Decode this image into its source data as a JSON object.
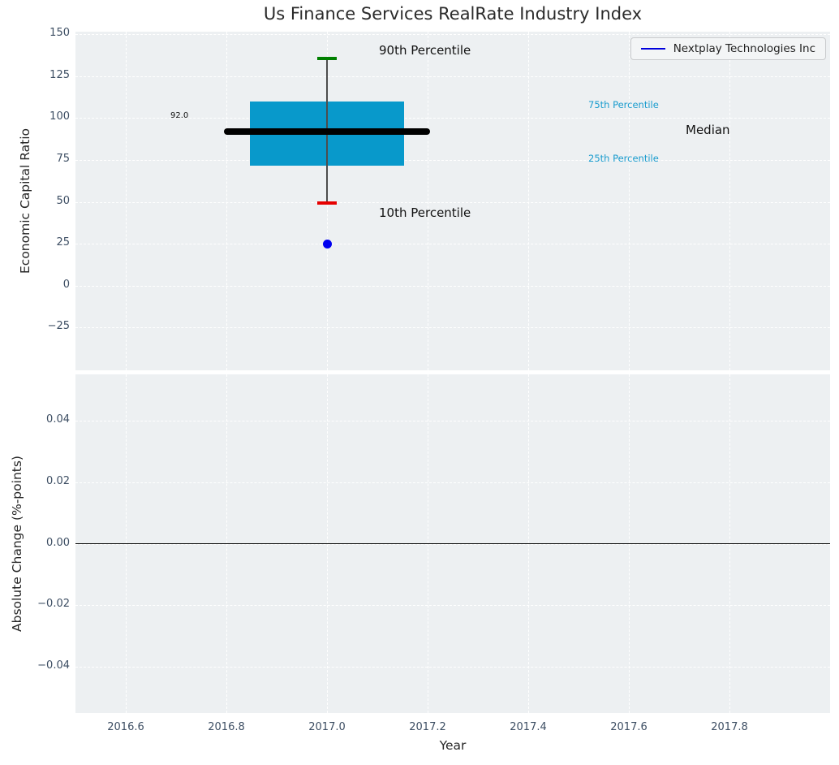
{
  "title": "Us Finance Services RealRate Industry Index",
  "colors": {
    "box_fill": "#0899cb",
    "median_line": "#000000",
    "p90_cap": "#008000",
    "p10_cap": "#e60000",
    "company_point": "#0000f0",
    "legend_line": "#0000dd",
    "percentile_label": "#1a9cce",
    "whisker": "#4d4d4d",
    "plot_background": "#edf0f2",
    "gridline": "#ffffff",
    "tick_label": "#3d4e63",
    "zero_line": "#000000"
  },
  "chart_data": [
    {
      "type": "box",
      "title": "Us Finance Services RealRate Industry Index",
      "xlabel": "Year",
      "ylabel": "Economic Capital Ratio",
      "xlim": [
        2016.5,
        2018.0
      ],
      "ylim": [
        -50.5,
        151.5
      ],
      "xticks": [
        2016.6,
        2016.8,
        2017.0,
        2017.2,
        2017.4,
        2017.6,
        2017.8
      ],
      "xtick_labels": [
        "2016.6",
        "2016.8",
        "2017.0",
        "2017.2",
        "2017.4",
        "2017.6",
        "2017.8"
      ],
      "yticks": [
        150,
        125,
        100,
        75,
        50,
        25,
        0,
        -25
      ],
      "ytick_labels": [
        "150",
        "125",
        "100",
        "75",
        "50",
        "25",
        "0",
        "−25"
      ],
      "grid": true,
      "box": {
        "x": 2017.0,
        "p90": 135.5,
        "p75": 110,
        "median": 92.0,
        "p25": 71.5,
        "p10": 49.3,
        "box_halfwidth_years": 0.153,
        "median_halfwidth_years": 0.205,
        "cap_halfwidth_years": 0.019
      },
      "company_point": {
        "name": "Nextplay Technologies Inc",
        "x": 2017.0,
        "y": 25
      },
      "median_annotation": "92.0",
      "labels": {
        "p90": "90th Percentile",
        "p10": "10th Percentile",
        "p75": "75th Percentile",
        "median": "Median",
        "p25": "25th Percentile"
      },
      "legend": {
        "position": "upper right",
        "entries": [
          {
            "label": "Nextplay Technologies Inc",
            "color": "#0000dd"
          }
        ]
      }
    },
    {
      "type": "line",
      "xlabel": "Year",
      "ylabel": "Absolute Change (%-points)",
      "xlim": [
        2016.5,
        2018.0
      ],
      "ylim": [
        -0.055,
        0.055
      ],
      "xticks": [
        2016.6,
        2016.8,
        2017.0,
        2017.2,
        2017.4,
        2017.6,
        2017.8
      ],
      "xtick_labels": [
        "2016.6",
        "2016.8",
        "2017.0",
        "2017.2",
        "2017.4",
        "2017.6",
        "2017.8"
      ],
      "yticks": [
        0.04,
        0.02,
        0.0,
        -0.02,
        -0.04
      ],
      "ytick_labels": [
        "0.04",
        "0.02",
        "0.00",
        "−0.02",
        "−0.04"
      ],
      "grid": true,
      "zero_line": 0.0,
      "series": []
    }
  ]
}
